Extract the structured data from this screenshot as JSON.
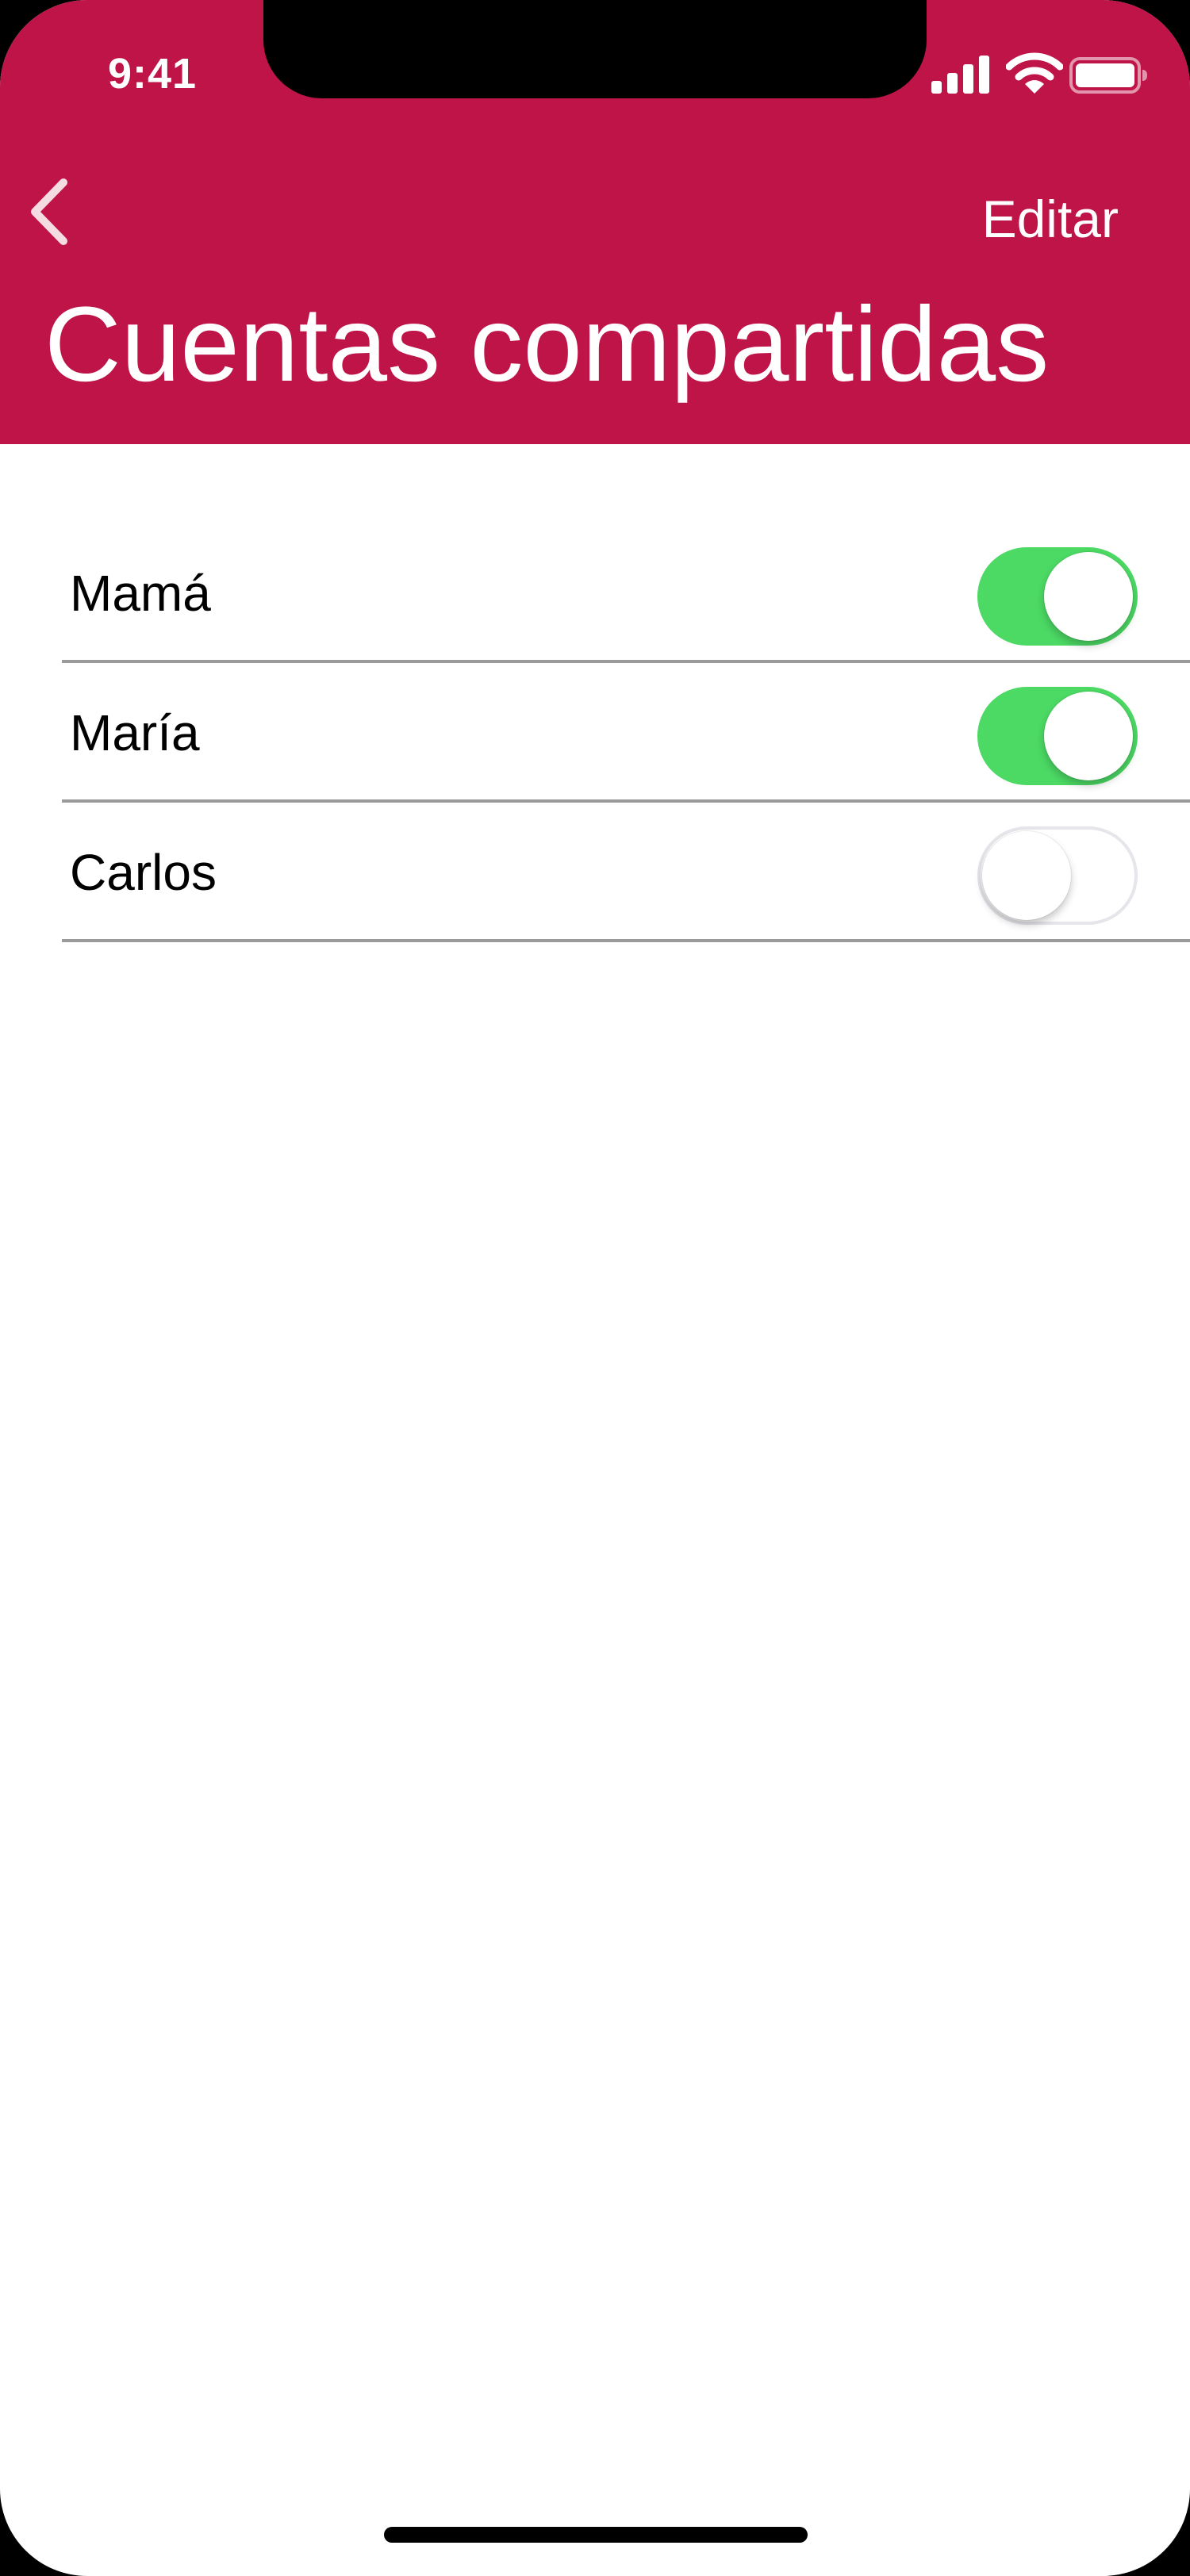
{
  "status_bar": {
    "time": "9:41",
    "icons": [
      "signal-icon",
      "wifi-icon",
      "battery-icon"
    ]
  },
  "nav": {
    "back_icon": "chevron-left-icon",
    "edit_label": "Editar",
    "title": "Cuentas compartidas"
  },
  "accounts": [
    {
      "name": "Mamá",
      "enabled": true
    },
    {
      "name": "María",
      "enabled": true
    },
    {
      "name": "Carlos",
      "enabled": false
    }
  ],
  "colors": {
    "header": "#be1448",
    "toggle_on": "#4cd964",
    "toggle_off_border": "#e5e5ea"
  }
}
